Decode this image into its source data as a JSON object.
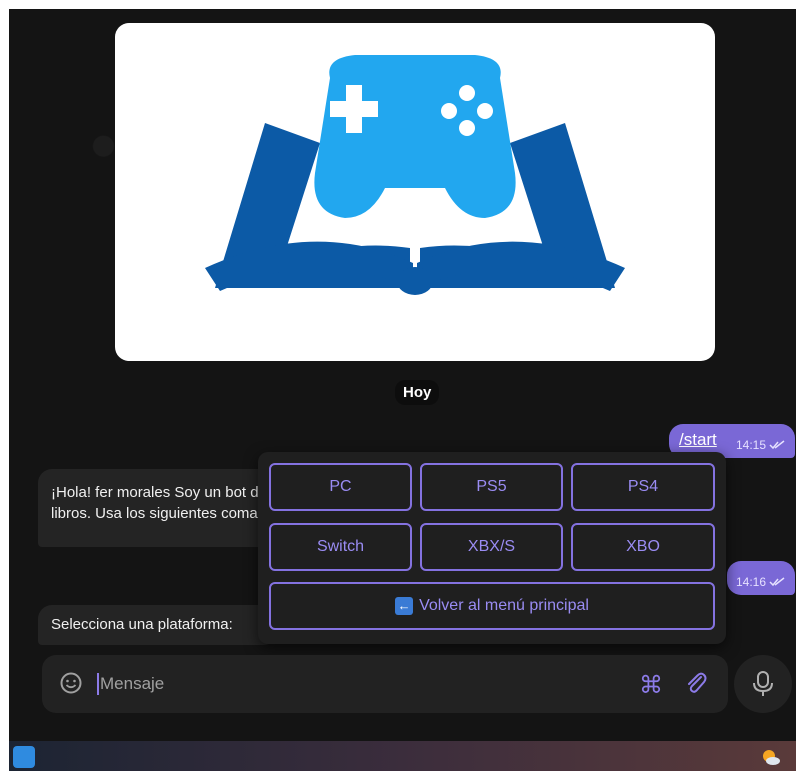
{
  "chat": {
    "date_label": "Hoy",
    "messages": [
      {
        "text": "/start",
        "time": "14:15"
      },
      {
        "text": "¡Hola! fer morales Soy un bot de libros. Usa los siguientes comandos"
      },
      {
        "time": "14:16"
      },
      {
        "text": "Selecciona una plataforma:"
      }
    ]
  },
  "keyboard": {
    "row1": [
      "PC",
      "PS5",
      "PS4"
    ],
    "row2": [
      "Switch",
      "XBX/S",
      "XBO"
    ],
    "back": "Volver al menú principal"
  },
  "composer": {
    "placeholder": "Mensaje"
  },
  "icons": {
    "emoji": "emoji-icon",
    "commands": "command-icon",
    "attach": "paperclip-icon",
    "mic": "microphone-icon",
    "read": "double-check-icon"
  },
  "colors": {
    "accent": "#7a68d6",
    "logo_blue": "#22a7ef",
    "book_blue": "#0c5aa6"
  }
}
